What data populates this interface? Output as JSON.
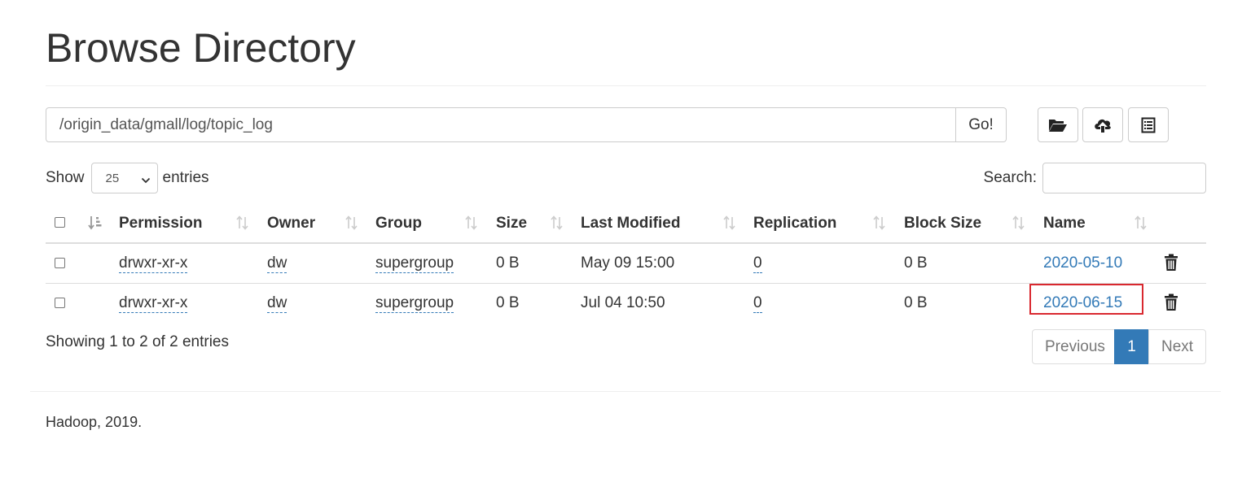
{
  "page": {
    "title": "Browse Directory"
  },
  "path_bar": {
    "value": "/origin_data/gmall/log/topic_log",
    "go_label": "Go!"
  },
  "toolbar": {
    "create_directory_icon": "folder-open-icon",
    "upload_icon": "cloud-upload-icon",
    "cut_paste_icon": "list-alt-icon"
  },
  "length": {
    "show_label": "Show",
    "selected": "25",
    "entries_label": "entries"
  },
  "search": {
    "label": "Search:",
    "value": ""
  },
  "table": {
    "columns": [
      "Permission",
      "Owner",
      "Group",
      "Size",
      "Last Modified",
      "Replication",
      "Block Size",
      "Name"
    ],
    "rows": [
      {
        "permission": "drwxr-xr-x",
        "owner": "dw",
        "group": "supergroup",
        "size": "0 B",
        "last_modified": "May 09 15:00",
        "replication": "0",
        "block_size": "0 B",
        "name": "2020-05-10"
      },
      {
        "permission": "drwxr-xr-x",
        "owner": "dw",
        "group": "supergroup",
        "size": "0 B",
        "last_modified": "Jul 04 10:50",
        "replication": "0",
        "block_size": "0 B",
        "name": "2020-06-15"
      }
    ]
  },
  "info": "Showing 1 to 2 of 2 entries",
  "pagination": {
    "previous": "Previous",
    "current": "1",
    "next": "Next"
  },
  "footer": {
    "text": "Hadoop, 2019."
  },
  "colors": {
    "link": "#337ab7",
    "highlight": "#d9282f",
    "active_page": "#337ab7"
  }
}
